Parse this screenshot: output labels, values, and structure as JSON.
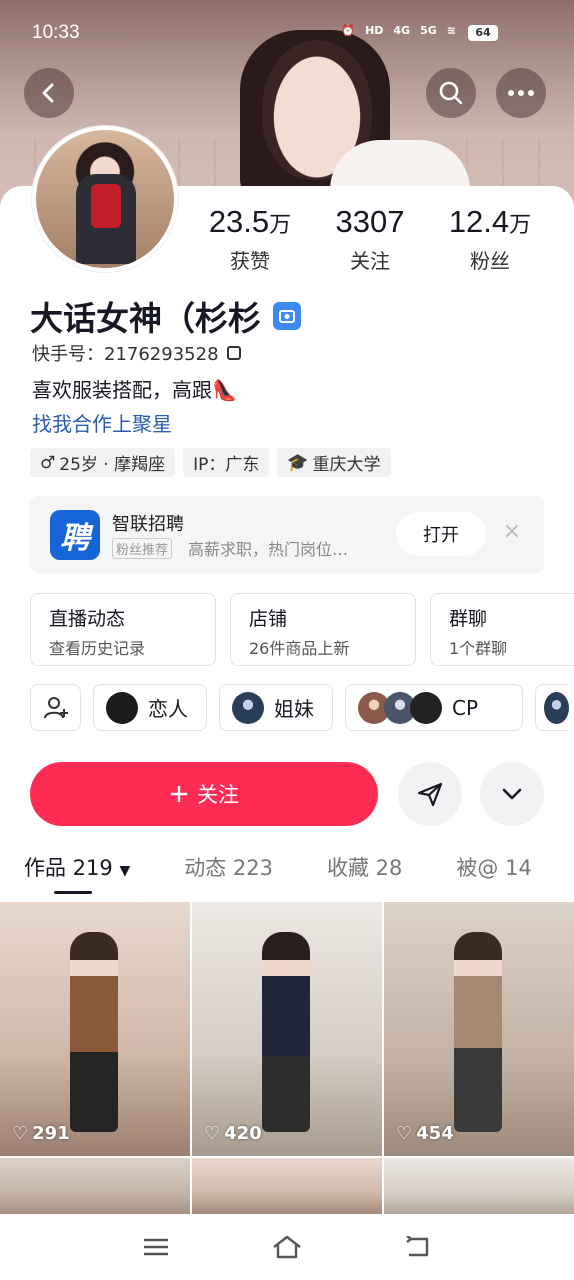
{
  "status_bar": {
    "time": "10:33",
    "net_hd": "HD",
    "net_4g": "4G",
    "net_5g": "5G",
    "battery": "64"
  },
  "header": {
    "back": "back-icon",
    "search": "search-icon",
    "more": "more-icon"
  },
  "stats": [
    {
      "num": "23.5",
      "unit": "万",
      "label": "获赞"
    },
    {
      "num": "3307",
      "unit": "",
      "label": "关注"
    },
    {
      "num": "12.4",
      "unit": "万",
      "label": "粉丝"
    }
  ],
  "profile": {
    "name": "大话女神（杉杉",
    "uid": "快手号：2176293528",
    "bio": "喜欢服装搭配，高跟👠",
    "link": "找我合作上聚星"
  },
  "tags": [
    {
      "icon": "♂",
      "text": "25岁 · 摩羯座"
    },
    {
      "icon": "",
      "text": "IP：广东"
    },
    {
      "icon": "🎓",
      "text": "重庆大学"
    }
  ],
  "ad": {
    "logo": "聘",
    "title": "智联招聘",
    "badge": "粉丝推荐",
    "desc": "高薪求职，热门岗位…",
    "open": "打开",
    "close": "×"
  },
  "shortcuts": [
    {
      "title": "直播动态",
      "sub": "查看历史记录"
    },
    {
      "title": "店铺",
      "sub": "26件商品上新"
    },
    {
      "title": "群聊",
      "sub": "1个群聊"
    }
  ],
  "relations": [
    {
      "label": "恋人"
    },
    {
      "label": "姐妹"
    },
    {
      "label": "CP"
    }
  ],
  "actions": {
    "follow": "关注"
  },
  "tabs": [
    {
      "label": "作品 219"
    },
    {
      "label": "动态 223"
    },
    {
      "label": "收藏 28"
    },
    {
      "label": "被@ 14"
    }
  ],
  "videos": [
    {
      "likes": "291"
    },
    {
      "likes": "420"
    },
    {
      "likes": "454"
    }
  ],
  "colors": {
    "accent": "#fe2c55",
    "link": "#2a5db0",
    "verified": "#3d8af7"
  }
}
